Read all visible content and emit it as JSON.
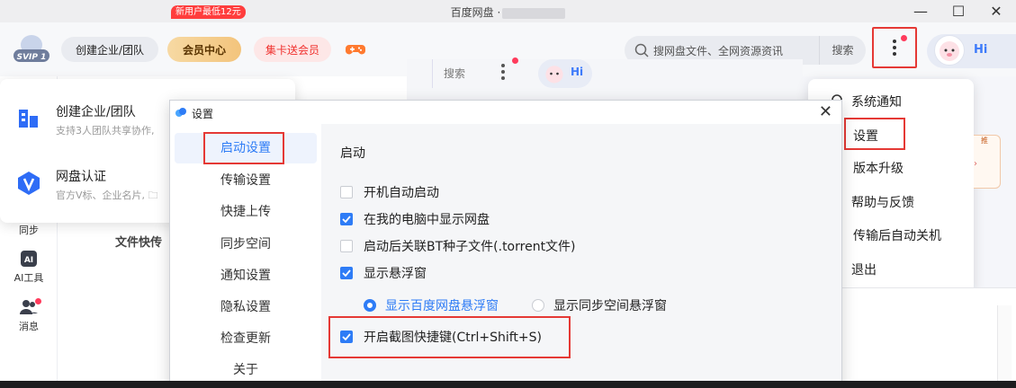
{
  "window": {
    "title": "百度网盘 ·",
    "minimize": "—",
    "maximize": "☐",
    "close": "✕"
  },
  "topbar": {
    "logo_text": "SVIP 1",
    "create_team": "创建企业/团队",
    "vip_tag": "新用户最低12元",
    "vip_center": "会员中心",
    "card_vip": "集卡送会员",
    "search_placeholder": "搜网盘文件、全网资源资讯",
    "search_button": "搜索",
    "hi": "Hi"
  },
  "mini_header": {
    "search_button": "搜索",
    "hi": "Hi"
  },
  "enterprise_popup": {
    "items": [
      {
        "title": "创建企业/团队",
        "subtitle": "支持3人团队共享协作,"
      },
      {
        "title": "网盘认证",
        "subtitle": "官方V标、企业名片, 🗀"
      }
    ]
  },
  "sidebar": {
    "items": [
      {
        "label": "同步"
      },
      {
        "label": "AI工具"
      },
      {
        "label": "消息"
      }
    ]
  },
  "background": {
    "file_transfer": "文件快传",
    "promo_tag": "推"
  },
  "menu": {
    "items": [
      {
        "label": "系统通知"
      },
      {
        "label": "设置"
      },
      {
        "label": "版本升级"
      },
      {
        "label": "帮助与反馈"
      },
      {
        "label": "传输后自动关机"
      },
      {
        "label": "退出"
      }
    ]
  },
  "dialog": {
    "title": "设置",
    "close": "✕",
    "nav": [
      {
        "label": "启动设置",
        "active": true
      },
      {
        "label": "传输设置",
        "active": false
      },
      {
        "label": "快捷上传",
        "active": false
      },
      {
        "label": "同步空间",
        "active": false
      },
      {
        "label": "通知设置",
        "active": false
      },
      {
        "label": "隐私设置",
        "active": false
      },
      {
        "label": "检查更新",
        "active": false
      },
      {
        "label": "关于",
        "active": false
      }
    ],
    "section_title": "启动",
    "options": [
      {
        "label": "开机自动启动",
        "checked": false
      },
      {
        "label": "在我的电脑中显示网盘",
        "checked": true
      },
      {
        "label": "启动后关联BT种子文件(.torrent文件)",
        "checked": false
      },
      {
        "label": "显示悬浮窗",
        "checked": true
      }
    ],
    "radios": [
      {
        "label": "显示百度网盘悬浮窗",
        "selected": true
      },
      {
        "label": "显示同步空间悬浮窗",
        "selected": false
      }
    ],
    "screenshot_option": {
      "label": "开启截图快捷键(Ctrl+Shift+S)",
      "checked": true
    }
  },
  "colors": {
    "accent": "#2e7cf6",
    "highlight": "#e53935",
    "badge": "#ff3b5c"
  }
}
